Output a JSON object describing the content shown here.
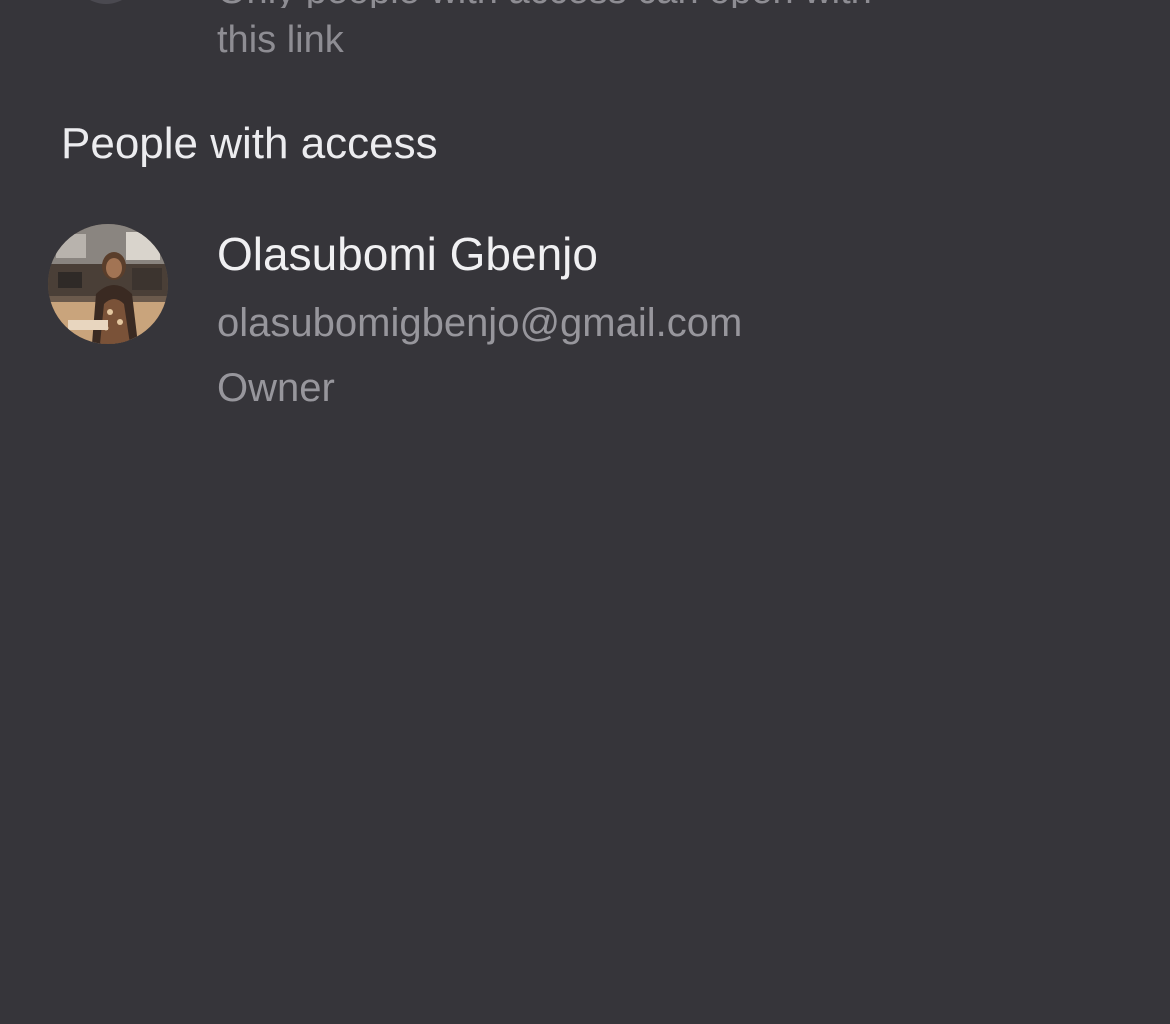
{
  "general_access": {
    "description_cut_top": "Only people with access can open with",
    "description_tail": "this link",
    "icon": "globe-icon"
  },
  "people_section": {
    "heading": "People with access",
    "people": [
      {
        "name": "Olasubomi Gbenjo",
        "email": "olasubomigbenjo@gmail.com",
        "role": "Owner",
        "avatar": "profile-photo"
      }
    ]
  },
  "colors": {
    "background": "#36353a",
    "primary_text": "#f0f0f2",
    "secondary_text": "#97969c"
  }
}
